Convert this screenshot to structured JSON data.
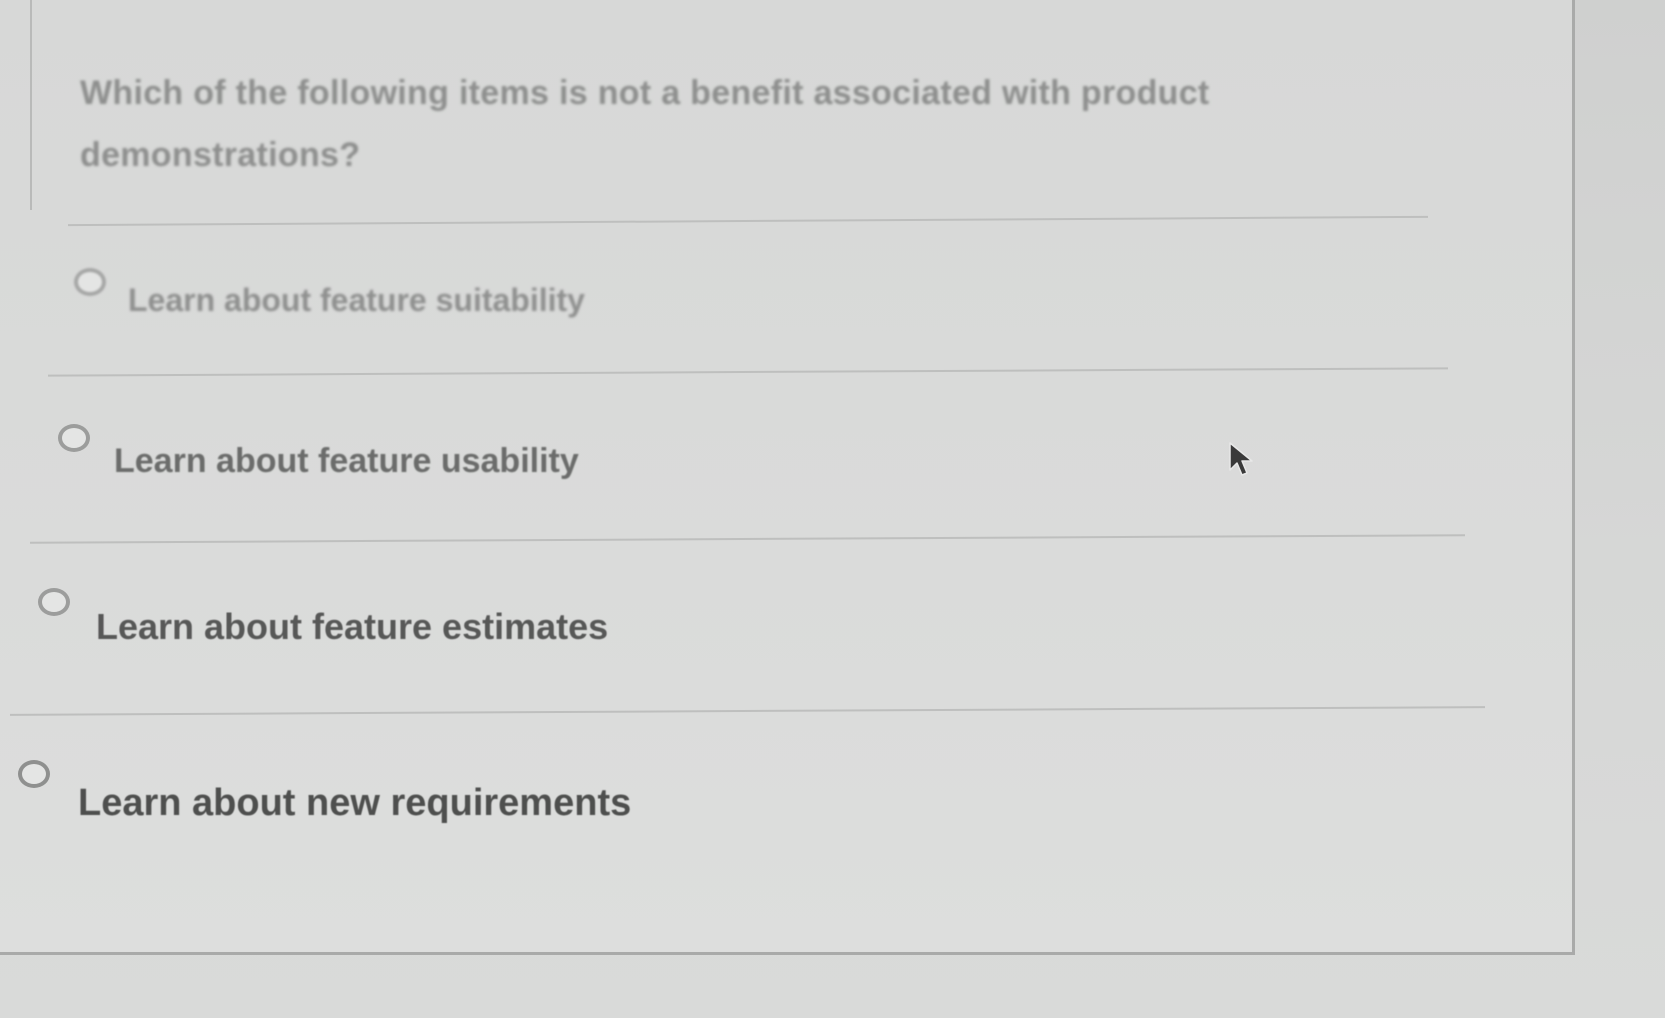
{
  "question": {
    "text": "Which of the following items is not a benefit associated with product demonstrations?"
  },
  "options": [
    {
      "label": "Learn about feature suitability",
      "selected": false
    },
    {
      "label": "Learn about feature usability",
      "selected": false
    },
    {
      "label": "Learn about feature estimates",
      "selected": false
    },
    {
      "label": "Learn about new requirements",
      "selected": false
    }
  ],
  "colors": {
    "background": "#d2d3d2",
    "card": "#d9dad9",
    "divider": "#bebfbe",
    "text": "#575857"
  },
  "icons": {
    "cursor": "mouse-pointer-arrow-icon"
  }
}
